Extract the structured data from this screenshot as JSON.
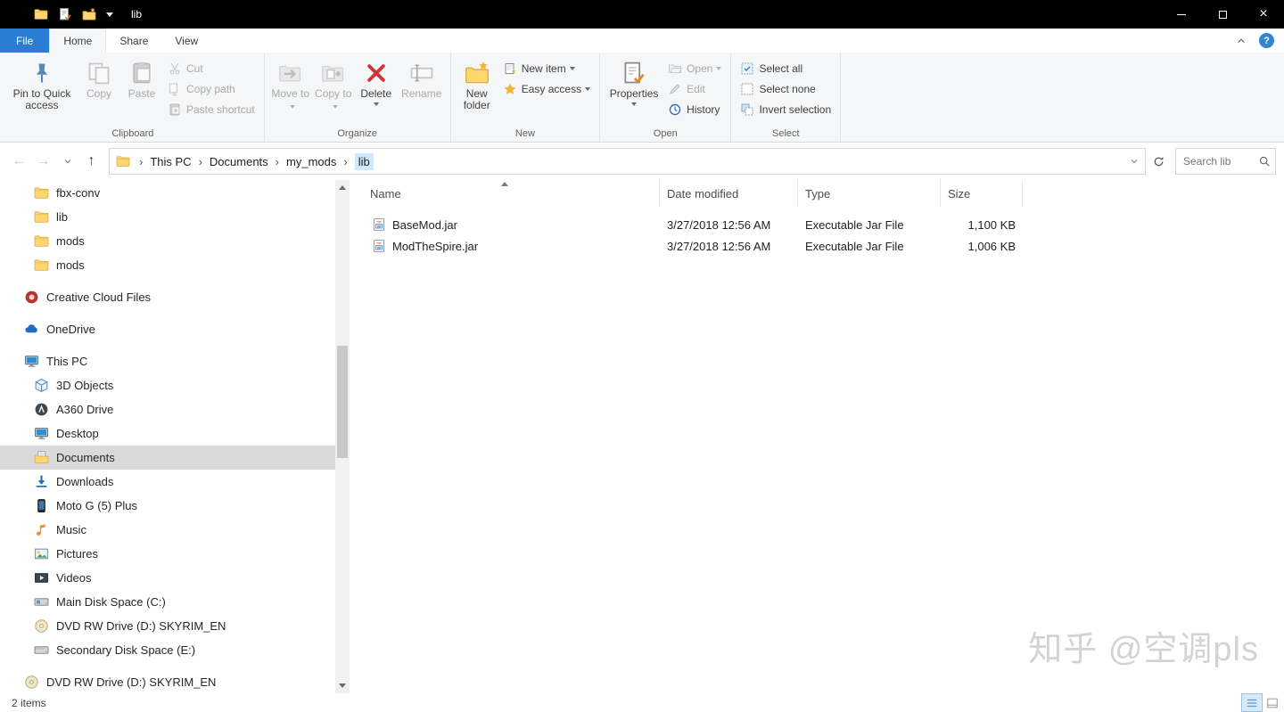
{
  "titlebar": {
    "title": "lib"
  },
  "icons": {
    "back": "←",
    "forward": "→",
    "up": "↑",
    "crumb_separator": "›",
    "help": "?",
    "close": "×"
  },
  "tabs": {
    "file": "File",
    "home": "Home",
    "share": "Share",
    "view": "View"
  },
  "ribbon": {
    "clipboard": {
      "label": "Clipboard",
      "pin": "Pin to Quick access",
      "copy": "Copy",
      "paste": "Paste",
      "cut": "Cut",
      "copy_path": "Copy path",
      "paste_shortcut": "Paste shortcut"
    },
    "organize": {
      "label": "Organize",
      "move_to": "Move to",
      "copy_to": "Copy to",
      "delete": "Delete",
      "rename": "Rename"
    },
    "new": {
      "label": "New",
      "new_folder": "New folder",
      "new_item": "New item",
      "easy_access": "Easy access"
    },
    "open": {
      "label": "Open",
      "properties": "Properties",
      "open": "Open",
      "edit": "Edit",
      "history": "History"
    },
    "select": {
      "label": "Select",
      "select_all": "Select all",
      "select_none": "Select none",
      "invert_selection": "Invert selection"
    }
  },
  "addressbar": {
    "crumbs": [
      "This PC",
      "Documents",
      "my_mods",
      "lib"
    ],
    "search_placeholder": "Search lib"
  },
  "sidebar": {
    "items": [
      {
        "label": "fbx-conv"
      },
      {
        "label": "lib"
      },
      {
        "label": "mods"
      },
      {
        "label": "mods"
      },
      {
        "label": "Creative Cloud Files"
      },
      {
        "label": "OneDrive"
      },
      {
        "label": "This PC"
      },
      {
        "label": "3D Objects"
      },
      {
        "label": "A360 Drive"
      },
      {
        "label": "Desktop"
      },
      {
        "label": "Documents"
      },
      {
        "label": "Downloads"
      },
      {
        "label": "Moto G (5) Plus"
      },
      {
        "label": "Music"
      },
      {
        "label": "Pictures"
      },
      {
        "label": "Videos"
      },
      {
        "label": "Main Disk Space (C:)"
      },
      {
        "label": "DVD RW Drive (D:) SKYRIM_EN"
      },
      {
        "label": "Secondary Disk Space (E:)"
      },
      {
        "label": "DVD RW Drive (D:) SKYRIM_EN"
      }
    ]
  },
  "files": {
    "columns": {
      "name": "Name",
      "date": "Date modified",
      "type": "Type",
      "size": "Size"
    },
    "rows": [
      {
        "name": "BaseMod.jar",
        "date": "3/27/2018 12:56 AM",
        "type": "Executable Jar File",
        "size": "1,100 KB"
      },
      {
        "name": "ModTheSpire.jar",
        "date": "3/27/2018 12:56 AM",
        "type": "Executable Jar File",
        "size": "1,006 KB"
      }
    ]
  },
  "statusbar": {
    "count": "2 items"
  },
  "watermark": "知乎 @空调pls"
}
